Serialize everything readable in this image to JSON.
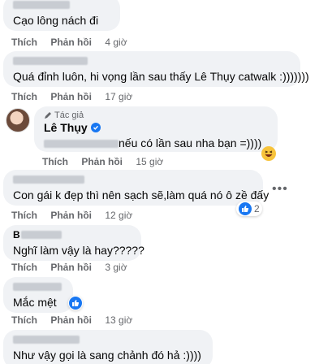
{
  "actions": {
    "like": "Thích",
    "reply": "Phản hồi"
  },
  "comments": [
    {
      "text": "Cạo lông nách đi",
      "time": "4 giờ"
    },
    {
      "text": "Quá đỉnh luôn, hi vọng lần sau thấy Lê Thụy catwalk :)))))))",
      "time": "17 giờ"
    },
    {
      "author_tag": "Tác giả",
      "author": "Lê Thụy",
      "text": "nếu có lần sau nha bạn =))))",
      "time": "15 giờ",
      "reaction": "haha-icon"
    },
    {
      "text": "Con gái k đẹp thì nên sạch sẽ,làm quá nó ô zề đấy",
      "time": "12 giờ",
      "reaction_count": "2"
    },
    {
      "name_partial": "B",
      "text": "Nghĩ làm vậy là hay?????",
      "time": "3 giờ"
    },
    {
      "text": "Mắc mệt",
      "time": "13 giờ"
    },
    {
      "text": "Như vậy gọi là sang chảnh đó hả :))))"
    }
  ],
  "menu_icon": "more-horizontal-icon"
}
